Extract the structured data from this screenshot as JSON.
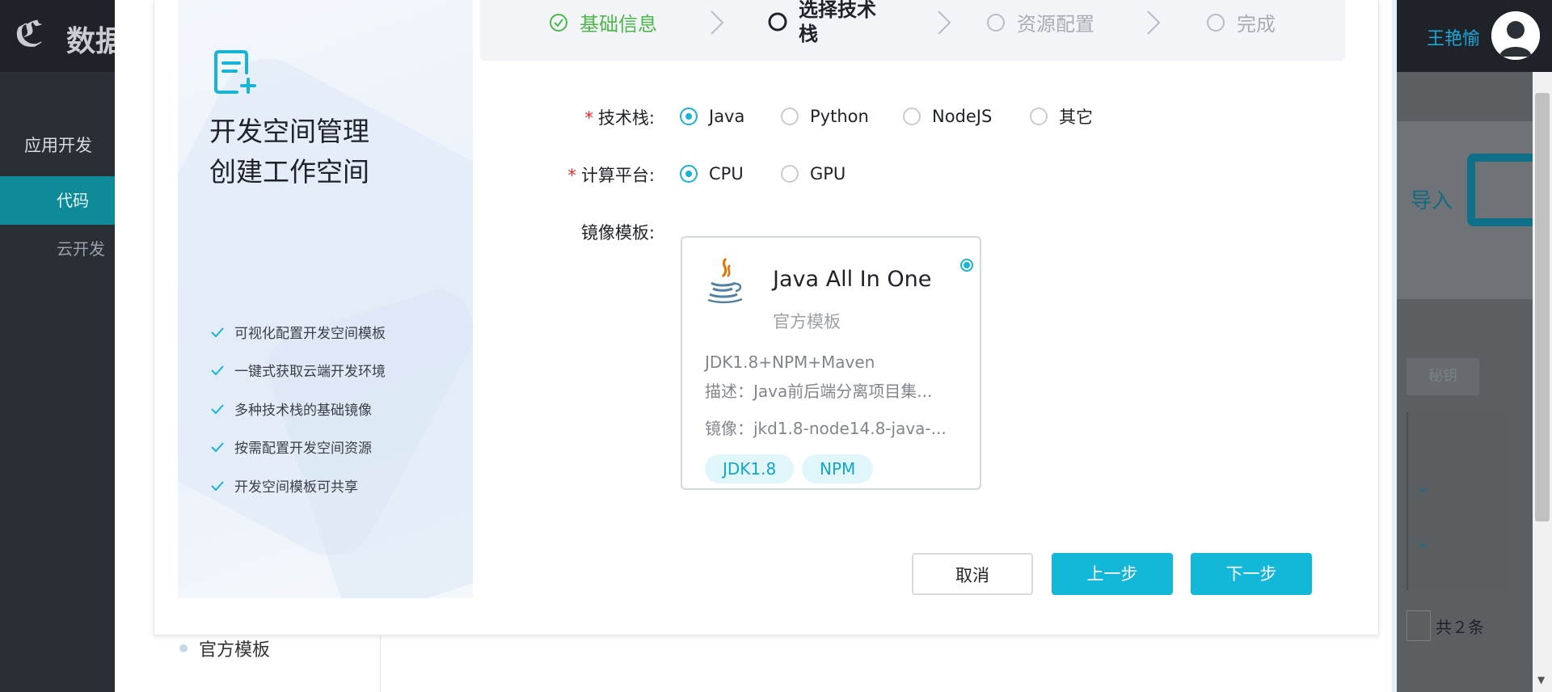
{
  "app": {
    "logo_text": "数据",
    "user_name": "王艳愉"
  },
  "sidebar": {
    "group_label": "应用开发",
    "items": [
      {
        "label": "代码"
      },
      {
        "label": "云开发"
      }
    ]
  },
  "background": {
    "import_label": "导入",
    "total_label": "共２条",
    "left_menu_item": "官方模板",
    "button_label": "秘钥"
  },
  "dialog": {
    "panel": {
      "title": "开发空间管理",
      "subtitle": "创建工作空间",
      "features": [
        "可视化配置开发空间模板",
        "一键式获取云端开发环境",
        "多种技术栈的基础镜像",
        "按需配置开发空间资源",
        "开发空间模板可共享"
      ]
    },
    "steps": [
      {
        "label": "基础信息",
        "state": "done"
      },
      {
        "label": "选择技术栈",
        "state": "active"
      },
      {
        "label": "资源配置",
        "state": "todo"
      },
      {
        "label": "完成",
        "state": "todo"
      }
    ],
    "form": {
      "tech_stack_label": "技术栈:",
      "tech_stack_options": [
        "Java",
        "Python",
        "NodeJS",
        "其它"
      ],
      "tech_stack_selected": "Java",
      "platform_label": "计算平台:",
      "platform_options": [
        "CPU",
        "GPU"
      ],
      "platform_selected": "CPU",
      "image_label": "镜像模板:"
    },
    "template_card": {
      "title": "Java All In One",
      "subtitle": "官方模板",
      "stack": "JDK1.8+NPM+Maven",
      "description": "描述：Java前后端分离项目集...",
      "image": "镜像：jkd1.8-node14.8-java-...",
      "tags": [
        "JDK1.8",
        "NPM"
      ],
      "selected": true
    },
    "buttons": {
      "cancel": "取消",
      "prev": "上一步",
      "next": "下一步"
    }
  },
  "colors": {
    "accent": "#13b8d8",
    "done_green": "#4cb849",
    "required_red": "#f5222d"
  }
}
